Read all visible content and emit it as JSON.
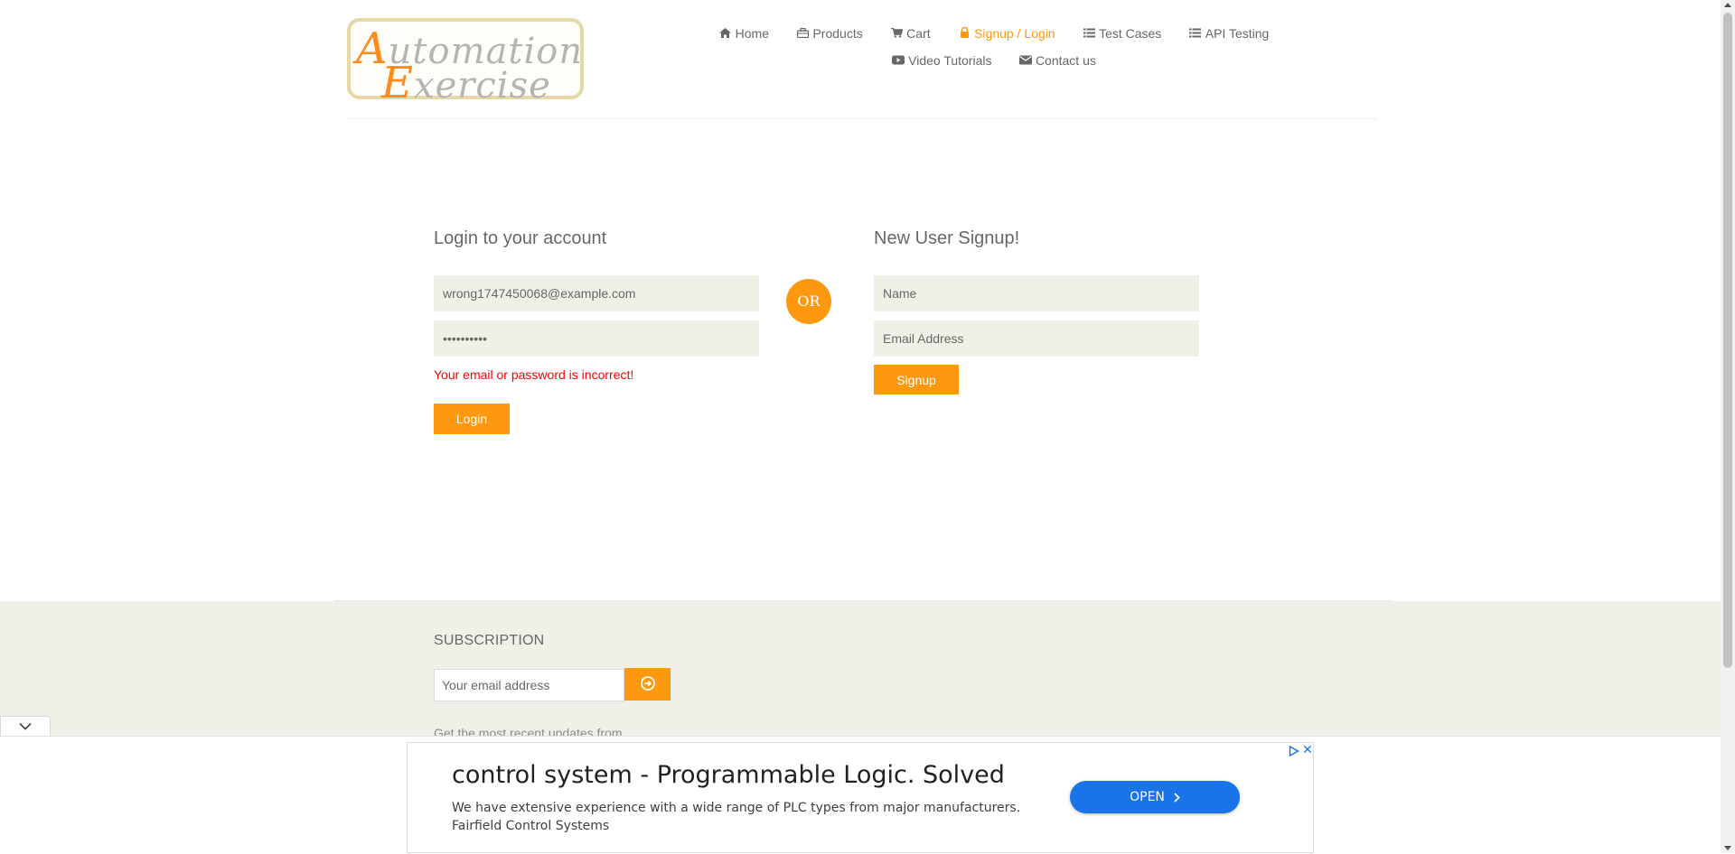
{
  "brand": {
    "logo_line1_initial": "A",
    "logo_line1_rest": "utomation",
    "logo_line2_initial": "E",
    "logo_line2_rest": "xercise"
  },
  "nav": {
    "items": [
      {
        "label": "Home",
        "icon": "home-icon",
        "active": false
      },
      {
        "label": "Products",
        "icon": "briefcase-icon",
        "active": false
      },
      {
        "label": "Cart",
        "icon": "cart-icon",
        "active": false
      },
      {
        "label": "Signup / Login",
        "icon": "lock-icon",
        "active": true
      },
      {
        "label": "Test Cases",
        "icon": "list-icon",
        "active": false
      },
      {
        "label": "API Testing",
        "icon": "list-icon",
        "active": false
      },
      {
        "label": "Video Tutorials",
        "icon": "youtube-icon",
        "active": false
      },
      {
        "label": "Contact us",
        "icon": "envelope-icon",
        "active": false
      }
    ]
  },
  "login": {
    "title": "Login to your account",
    "email_value": "wrong1747450068@example.com",
    "password_value": "••••••••••",
    "error_message": "Your email or password is incorrect!",
    "button_label": "Login"
  },
  "divider": {
    "or_label": "OR"
  },
  "signup": {
    "title": "New User Signup!",
    "name_placeholder": "Name",
    "email_placeholder": "Email Address",
    "button_label": "Signup"
  },
  "footer": {
    "subscription_title": "SUBSCRIPTION",
    "email_placeholder": "Your email address",
    "subscription_text": "Get the most recent updates from"
  },
  "ad": {
    "title": "control system - Programmable Logic. Solved",
    "description": "We have extensive experience with a wide range of PLC types from major manufacturers. Fairfield Control Systems",
    "open_label": "OPEN",
    "close_label": "✕"
  },
  "colors": {
    "accent": "#fe980f",
    "error": "#ff0000",
    "field_background": "#f0f0e9",
    "ad_button": "#1a73e8"
  }
}
